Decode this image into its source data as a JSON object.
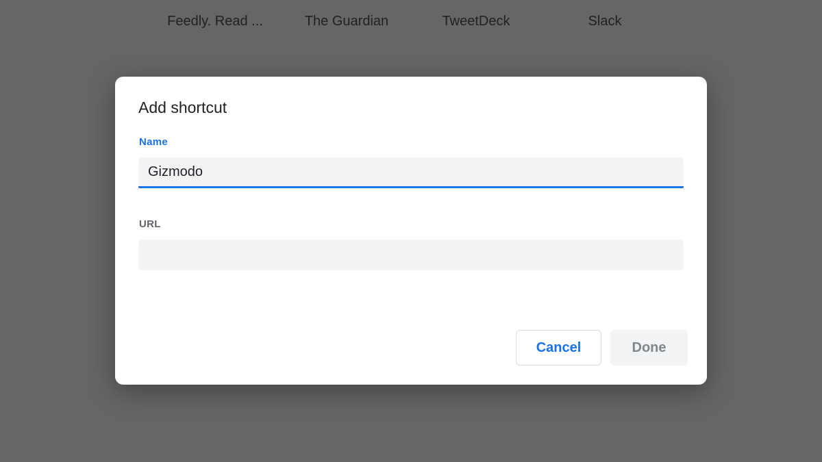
{
  "shortcuts": [
    {
      "label": "Feedly. Read ..."
    },
    {
      "label": "The Guardian"
    },
    {
      "label": "TweetDeck"
    },
    {
      "label": "Slack"
    }
  ],
  "dialog": {
    "title": "Add shortcut",
    "name_label": "Name",
    "name_value": "Gizmodo",
    "url_label": "URL",
    "url_value": "",
    "cancel_label": "Cancel",
    "done_label": "Done"
  },
  "colors": {
    "accent": "#1a73e8",
    "backdrop": "#666666",
    "field_bg": "#f1f3f4"
  }
}
